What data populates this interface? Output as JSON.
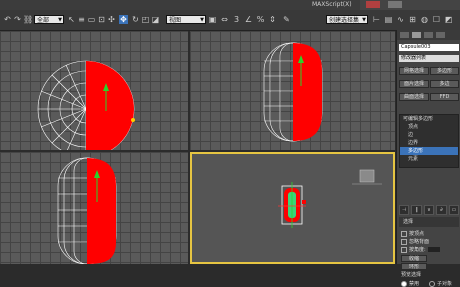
{
  "menu": [
    "",
    "",
    "",
    "",
    "",
    "",
    "",
    "",
    "",
    "",
    "",
    "",
    "",
    "",
    "MAXScript(X)",
    ""
  ],
  "toolbar": {
    "selection_filter": "全部",
    "ref_coord": "视图",
    "named_selection": "创建选择集"
  },
  "colors": {
    "object_red": "#ff0000",
    "wireframe": "#ffffff",
    "gizmo_green": "#3ad43a",
    "selection_yellow": "#e6c542",
    "highlight_blue": "#3b73b9"
  },
  "panel": {
    "object_name": "Capsule003",
    "modifier_list": "修改器列表",
    "buttons": [
      "网格选择",
      "多边形",
      "面片选择",
      "多边",
      "曲面选择",
      "FFD"
    ],
    "stack_items": [
      {
        "label": "可编辑多边形",
        "selected": false,
        "top": true
      },
      {
        "label": "顶点",
        "selected": false,
        "top": false
      },
      {
        "label": "边",
        "selected": false,
        "top": false
      },
      {
        "label": "边界",
        "selected": false,
        "top": false
      },
      {
        "label": "多边形",
        "selected": true,
        "top": false
      },
      {
        "label": "元素",
        "selected": false,
        "top": false
      }
    ],
    "stack_icons": [
      "⊣",
      "‖",
      "∨",
      "∂",
      "▭"
    ],
    "rollout": "选择",
    "options": [
      {
        "label": "按顶点",
        "type": "check",
        "on": false
      },
      {
        "label": "忽略背面",
        "type": "check",
        "on": false
      },
      {
        "label": "按角度:",
        "type": "check",
        "on": false,
        "spinner": true
      },
      {
        "label": "收缩",
        "type": "button"
      },
      {
        "label": "环形",
        "type": "button"
      },
      {
        "label": "预览选择",
        "type": "label"
      },
      {
        "label": "禁用",
        "type": "radio",
        "on": true
      },
      {
        "label": "子对象",
        "type": "radio",
        "on": false
      }
    ]
  }
}
